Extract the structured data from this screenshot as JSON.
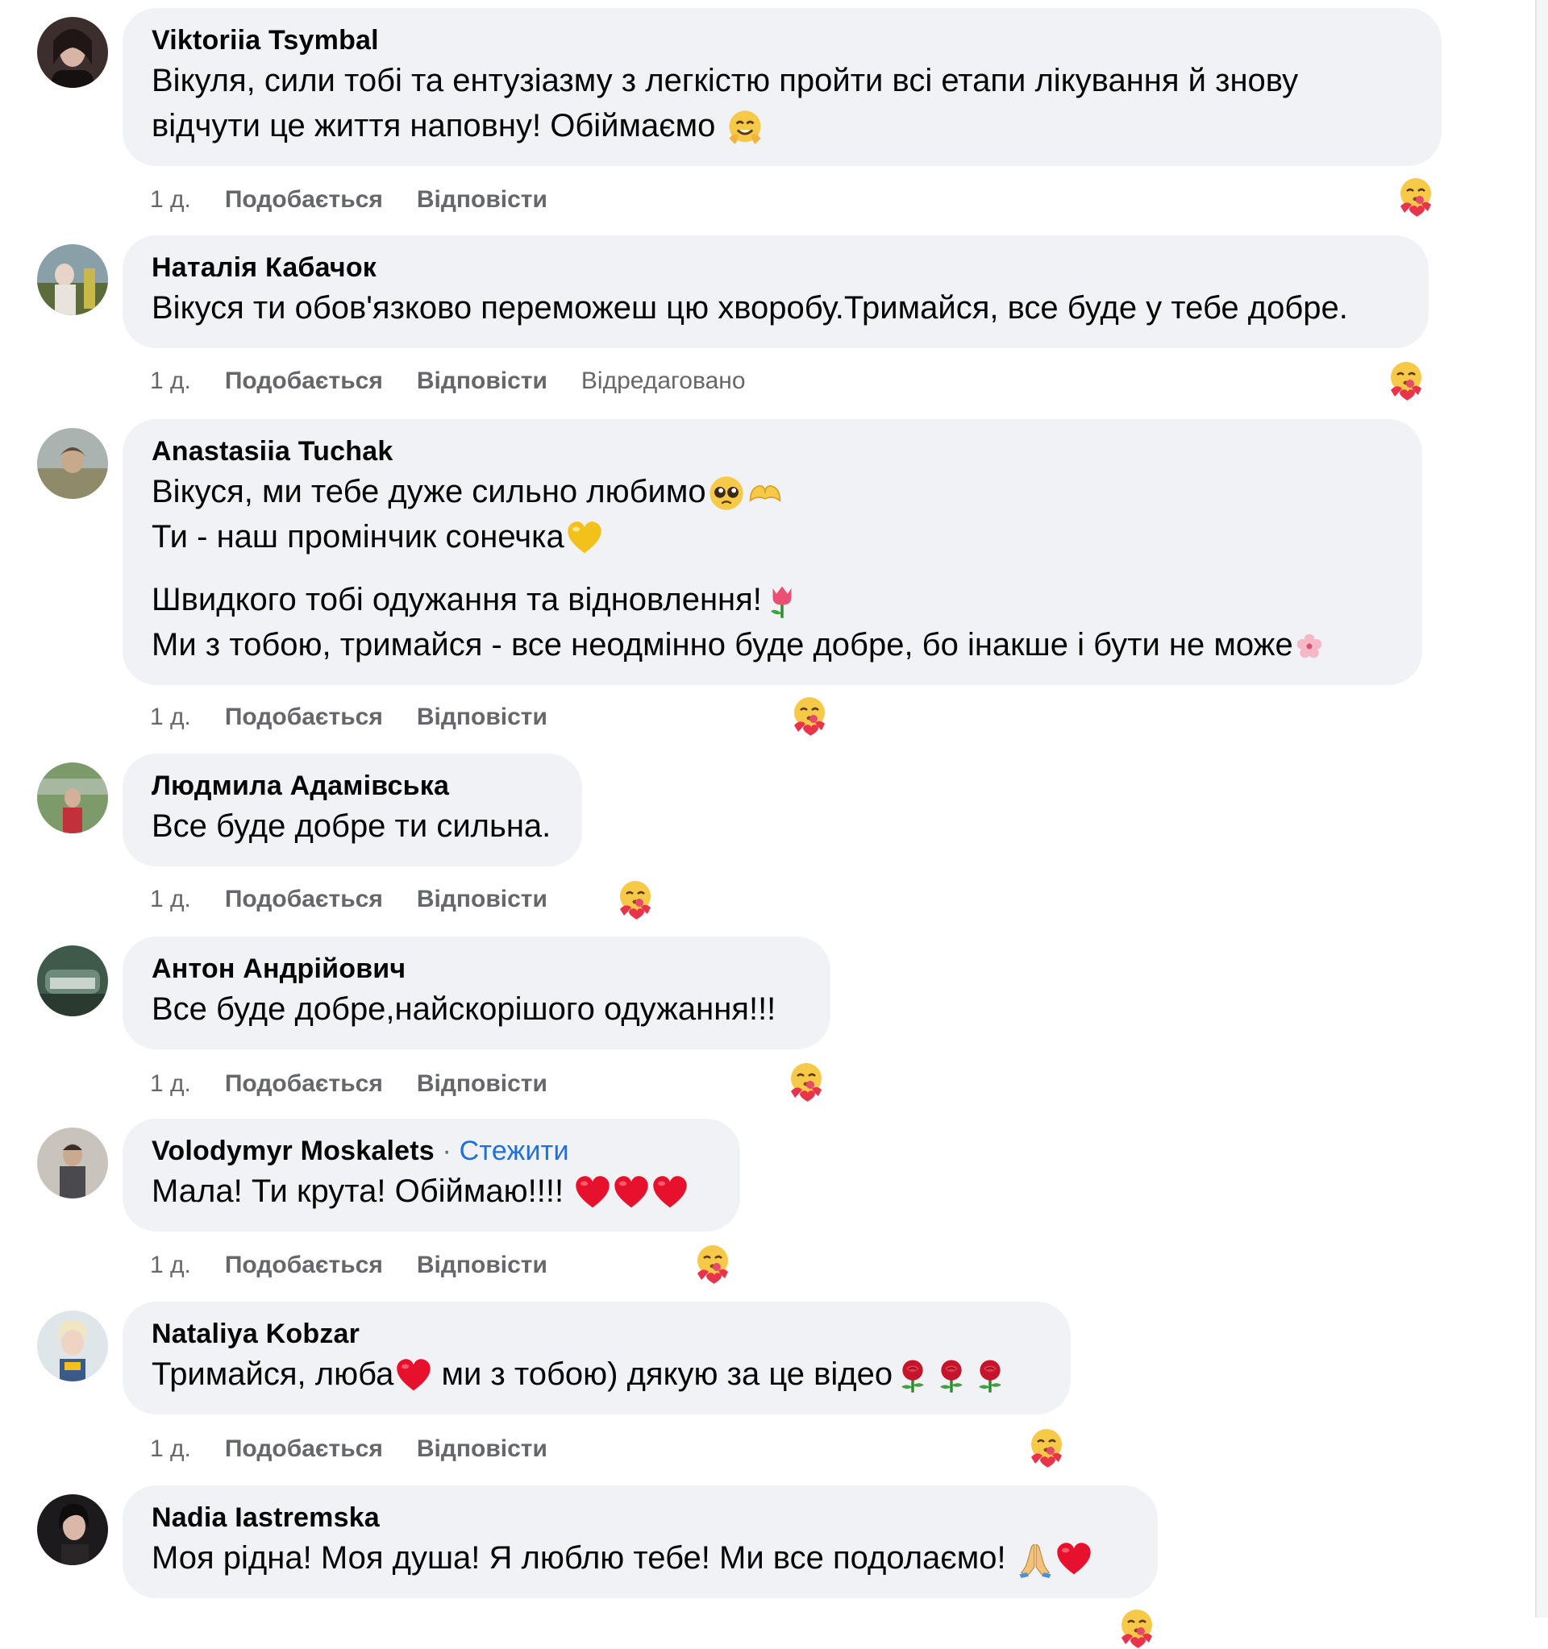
{
  "comments": [
    {
      "author": "Viktoriia Tsymbal",
      "lines": [
        "Вікуля, сили тобі та ентузіазму з легкістю пройти всі етапи лікування й знову",
        "відчути це життя наповну! Обіймаємо"
      ],
      "time": "1 д.",
      "like_label": "Подобається",
      "reply_label": "Відповісти",
      "reaction": "hug-reaction-icon"
    },
    {
      "author": "Наталія Кабачок",
      "lines": [
        "Вікуся ти обов'язково переможеш цю хворобу.Тримайся, все буде у тебе добре."
      ],
      "time": "1 д.",
      "like_label": "Подобається",
      "reply_label": "Відповісти",
      "edited_label": "Відредаговано",
      "reaction": "hug-reaction-icon"
    },
    {
      "author": "Anastasiia Tuchak",
      "lines": [
        "Вікуся, ми тебе дуже сильно любимо",
        "Ти - наш промінчик сонечка",
        "Швидкого тобі одужання та відновлення!",
        "Ми з тобою, тримайся - все неодмінно буде добре, бо інакше і бути не може"
      ],
      "time": "1 д.",
      "like_label": "Подобається",
      "reply_label": "Відповісти",
      "reaction": "hug-reaction-icon"
    },
    {
      "author": "Людмила Адамівська",
      "lines": [
        "Все буде добре ти сильна."
      ],
      "time": "1 д.",
      "like_label": "Подобається",
      "reply_label": "Відповісти",
      "reaction": "hug-reaction-icon"
    },
    {
      "author": "Антон Андрійович",
      "lines": [
        "Все буде добре,найскорішого одужання!!!"
      ],
      "time": "1 д.",
      "like_label": "Подобається",
      "reply_label": "Відповісти",
      "reaction": "hug-reaction-icon"
    },
    {
      "author": "Volodymyr Moskalets",
      "separator": " · ",
      "follow_label": "Стежити",
      "lines": [
        "Мала! Ти крута! Обіймаю!!!!"
      ],
      "time": "1 д.",
      "like_label": "Подобається",
      "reply_label": "Відповісти",
      "reaction": "hug-reaction-icon"
    },
    {
      "author": "Nataliya Kobzar",
      "lines": [
        "Тримайся, люба",
        " ми з тобою) дякую за це відео"
      ],
      "time": "1 д.",
      "like_label": "Подобається",
      "reply_label": "Відповісти",
      "reaction": "hug-reaction-icon"
    },
    {
      "author": "Nadia Iastremska",
      "lines": [
        "Моя рідна! Моя душа! Я люблю тебе! Ми все подолаємо! "
      ],
      "reaction": "hug-reaction-icon"
    }
  ],
  "colors": {
    "bubble": "#f0f2f5",
    "meta_text": "#65676b",
    "link": "#216fdb",
    "text": "#050505"
  }
}
